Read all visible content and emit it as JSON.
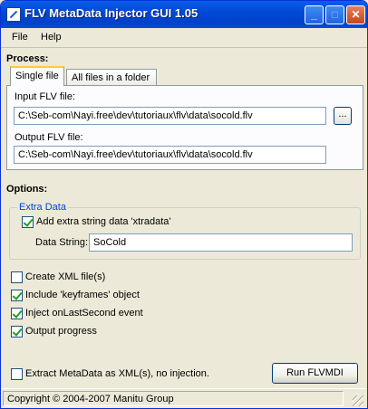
{
  "window": {
    "title": "FLV MetaData Injector GUI 1.05"
  },
  "menu": {
    "file": "File",
    "help": "Help"
  },
  "process": {
    "heading": "Process:",
    "tabs": [
      "Single file",
      "All files in a folder"
    ],
    "input_label": "Input FLV file:",
    "input_value": "C:\\Seb-com\\Nayi.free\\dev\\tutoriaux\\flv\\data\\socold.flv",
    "browse_label": "...",
    "output_label": "Output FLV file:",
    "output_value": "C:\\Seb-com\\Nayi.free\\dev\\tutoriaux\\flv\\data\\socold.flv"
  },
  "options": {
    "heading": "Options:",
    "extra_group_label": "Extra Data",
    "add_extra_label": "Add extra string data 'xtradata'",
    "data_string_label": "Data String:",
    "data_string_value": "SoCold",
    "create_xml": "Create XML file(s)",
    "include_keyframes": "Include 'keyframes' object",
    "inject_onlastsecond": "Inject onLastSecond event",
    "output_progress": "Output progress",
    "extract_metadata": "Extract MetaData as XML(s), no injection."
  },
  "run_button": "Run FLVMDI",
  "status": "Copyright © 2004-2007 Manitu Group"
}
